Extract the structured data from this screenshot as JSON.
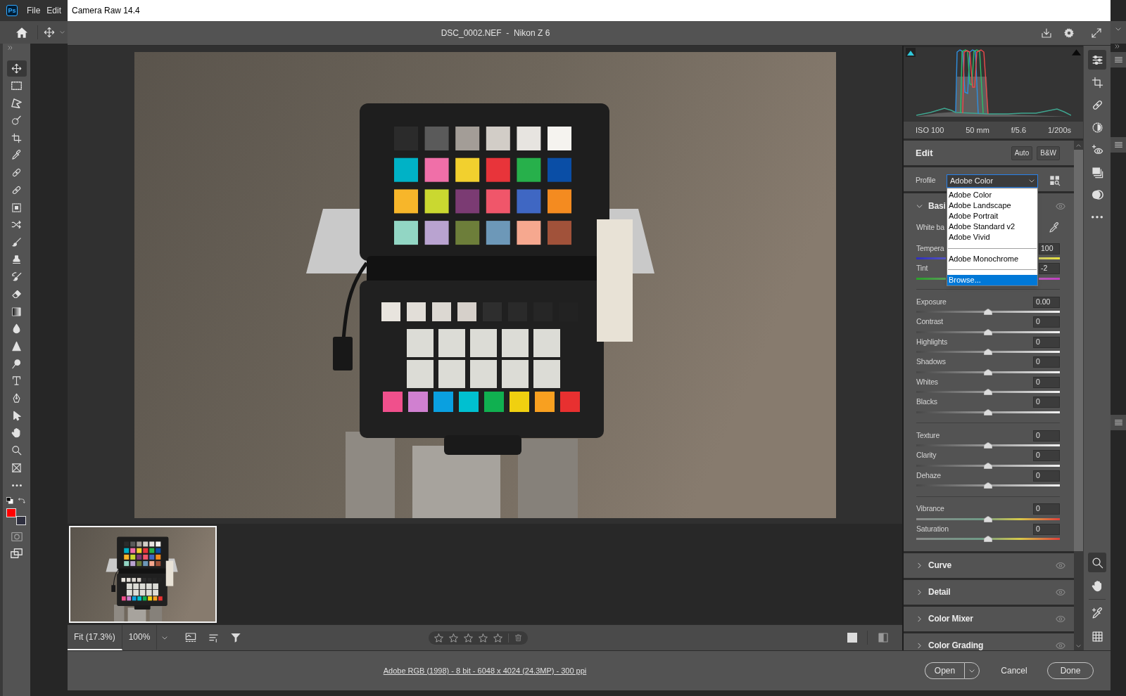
{
  "app": {
    "logo": "Ps",
    "menu": [
      "File",
      "Edit"
    ]
  },
  "toolbar": {
    "tools": [
      {
        "kind": "move",
        "selected": true
      },
      {
        "kind": "marquee",
        "selected": false
      },
      {
        "kind": "lasso",
        "selected": false
      },
      {
        "kind": "quickselect",
        "selected": false
      },
      {
        "kind": "crop",
        "selected": false
      },
      {
        "kind": "eyedropper",
        "selected": false
      },
      {
        "kind": "spotheal",
        "selected": false
      },
      {
        "kind": "bandage",
        "selected": false
      },
      {
        "kind": "patch",
        "selected": false
      },
      {
        "kind": "shuffle",
        "selected": false
      },
      {
        "kind": "brush",
        "selected": false
      },
      {
        "kind": "stamp",
        "selected": false
      },
      {
        "kind": "historybrush",
        "selected": false
      },
      {
        "kind": "eraser",
        "selected": false
      },
      {
        "kind": "gradient",
        "selected": false
      },
      {
        "kind": "blur",
        "selected": false
      },
      {
        "kind": "sharpen",
        "selected": false
      },
      {
        "kind": "dodge",
        "selected": false
      },
      {
        "kind": "type",
        "selected": false
      },
      {
        "kind": "pen",
        "selected": false
      },
      {
        "kind": "pointer",
        "selected": false
      },
      {
        "kind": "hand",
        "selected": false
      },
      {
        "kind": "zoom",
        "selected": false
      },
      {
        "kind": "frame",
        "selected": false
      },
      {
        "kind": "more",
        "selected": false
      }
    ],
    "color_swatches": [
      {
        "color": "#ff0000"
      },
      {
        "color": "#2f3040"
      }
    ]
  },
  "dialog": {
    "title": "Camera Raw 14.4"
  },
  "header": {
    "title": "DSC_0002.NEF  -  Nikon Z 6"
  },
  "filmstrip": [
    {
      "selected": true
    }
  ],
  "bottom_toolbar": {
    "zoom_levels": [
      {
        "label": "Fit (17.3%)",
        "selected": true
      },
      {
        "label": "100%",
        "selected": false
      }
    ],
    "rating": {
      "stars": 0
    }
  },
  "panel": {
    "exif": [
      "ISO 100",
      "50 mm",
      "f/5.6",
      "1/200s"
    ],
    "edit": {
      "title": "Edit",
      "buttons": [
        "Auto",
        "B&W"
      ]
    },
    "profile": {
      "label": "Profile",
      "value": "Adobe Color",
      "expanded": true,
      "menu": [
        {
          "items": [
            {
              "label": "Adobe Color",
              "selected": false
            },
            {
              "label": "Adobe Landscape",
              "selected": false
            },
            {
              "label": "Adobe Portrait",
              "selected": false
            },
            {
              "label": "Adobe Standard v2",
              "selected": false
            },
            {
              "label": "Adobe Vivid",
              "selected": false
            }
          ]
        },
        {
          "items": [
            {
              "label": "Adobe Monochrome",
              "selected": false
            }
          ]
        },
        {
          "items": [
            {
              "label": "Browse...",
              "selected": true
            }
          ]
        }
      ]
    },
    "basic": {
      "title": "Basi",
      "expanded": true,
      "white_balance": "White ba",
      "white_balance_sliders": [
        {
          "label": "Tempera",
          "value": "100",
          "kind": "temperature"
        },
        {
          "label": "Tint",
          "value": "-2",
          "kind": "tint"
        }
      ],
      "groups": [
        {
          "sliders": [
            {
              "label": "Exposure",
              "value": "0.00",
              "level": 0.5,
              "kind": "tone"
            },
            {
              "label": "Contrast",
              "value": "0",
              "level": 0.5,
              "kind": "tone"
            },
            {
              "label": "Highlights",
              "value": "0",
              "level": 0.5,
              "kind": "tone"
            },
            {
              "label": "Shadows",
              "value": "0",
              "level": 0.5,
              "kind": "tone"
            },
            {
              "label": "Whites",
              "value": "0",
              "level": 0.5,
              "kind": "tone"
            },
            {
              "label": "Blacks",
              "value": "0",
              "level": 0.5,
              "kind": "tone"
            }
          ]
        },
        {
          "sliders": [
            {
              "label": "Texture",
              "value": "0",
              "level": 0.5,
              "kind": "tone"
            },
            {
              "label": "Clarity",
              "value": "0",
              "level": 0.5,
              "kind": "tone"
            },
            {
              "label": "Dehaze",
              "value": "0",
              "level": 0.5,
              "kind": "tone"
            }
          ]
        },
        {
          "sliders": [
            {
              "label": "Vibrance",
              "value": "0",
              "level": 0.5,
              "kind": "saturation"
            },
            {
              "label": "Saturation",
              "value": "0",
              "level": 0.5,
              "kind": "saturation"
            }
          ]
        }
      ]
    },
    "sections": [
      {
        "title": "Curve",
        "expanded": false
      },
      {
        "title": "Detail",
        "expanded": false
      },
      {
        "title": "Color Mixer",
        "expanded": false
      },
      {
        "title": "Color Grading",
        "expanded": false
      }
    ]
  },
  "side_tools": [
    {
      "kind": "edit",
      "selected": true
    },
    {
      "kind": "crop",
      "selected": false
    },
    {
      "kind": "healing",
      "selected": false
    },
    {
      "kind": "masking",
      "selected": false
    },
    {
      "kind": "redeye",
      "selected": false
    },
    {
      "kind": "presets",
      "selected": false
    },
    {
      "kind": "snapshots",
      "selected": false
    },
    {
      "kind": "more",
      "selected": false
    }
  ],
  "view_tools": [
    {
      "tools": [
        {
          "kind": "zoom",
          "selected": true
        },
        {
          "kind": "hand",
          "selected": false
        }
      ]
    },
    {
      "tools": [
        {
          "kind": "sampler",
          "selected": false
        },
        {
          "kind": "grid",
          "selected": false
        }
      ]
    }
  ],
  "footer": {
    "image_info": "Adobe RGB (1998) - 8 bit - 6048 x 4024 (24.3MP) - 300 ppi",
    "buttons": [
      {
        "label": "Open",
        "kind": "split"
      },
      {
        "label": "Cancel",
        "kind": "text"
      },
      {
        "label": "Done",
        "kind": "outline"
      }
    ]
  }
}
